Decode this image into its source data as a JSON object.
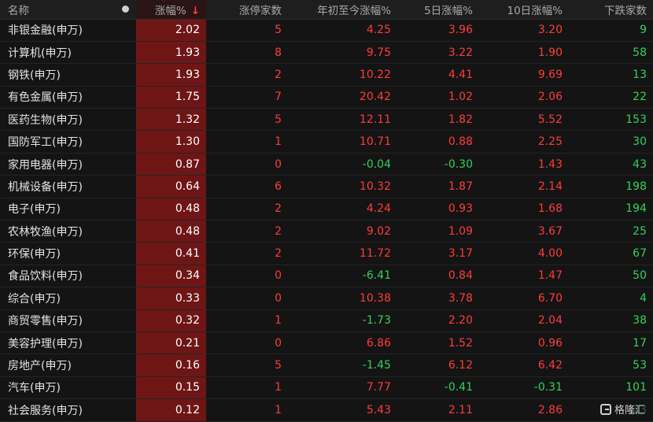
{
  "columns": {
    "name": "名称",
    "change": "涨幅%",
    "sort_indicator": "↓",
    "limit_up": "涨停家数",
    "ytd": "年初至今涨幅%",
    "d5": "5日涨幅%",
    "d10": "10日涨幅%",
    "decliners": "下跌家数"
  },
  "rows": [
    {
      "name": "非银金融(申万)",
      "change": "2.02",
      "limit_up": "5",
      "ytd": "4.25",
      "d5": "3.96",
      "d10": "3.20",
      "decliners": "9"
    },
    {
      "name": "计算机(申万)",
      "change": "1.93",
      "limit_up": "8",
      "ytd": "9.75",
      "d5": "3.22",
      "d10": "1.90",
      "decliners": "58"
    },
    {
      "name": "钢铁(申万)",
      "change": "1.93",
      "limit_up": "2",
      "ytd": "10.22",
      "d5": "4.41",
      "d10": "9.69",
      "decliners": "13"
    },
    {
      "name": "有色金属(申万)",
      "change": "1.75",
      "limit_up": "7",
      "ytd": "20.42",
      "d5": "1.02",
      "d10": "2.06",
      "decliners": "22"
    },
    {
      "name": "医药生物(申万)",
      "change": "1.32",
      "limit_up": "5",
      "ytd": "12.11",
      "d5": "1.82",
      "d10": "5.52",
      "decliners": "153"
    },
    {
      "name": "国防军工(申万)",
      "change": "1.30",
      "limit_up": "1",
      "ytd": "10.71",
      "d5": "0.88",
      "d10": "2.25",
      "decliners": "30"
    },
    {
      "name": "家用电器(申万)",
      "change": "0.87",
      "limit_up": "0",
      "ytd": "-0.04",
      "d5": "-0.30",
      "d10": "1.43",
      "decliners": "43"
    },
    {
      "name": "机械设备(申万)",
      "change": "0.64",
      "limit_up": "6",
      "ytd": "10.32",
      "d5": "1.87",
      "d10": "2.14",
      "decliners": "198"
    },
    {
      "name": "电子(申万)",
      "change": "0.48",
      "limit_up": "2",
      "ytd": "4.24",
      "d5": "0.93",
      "d10": "1.68",
      "decliners": "194"
    },
    {
      "name": "农林牧渔(申万)",
      "change": "0.48",
      "limit_up": "2",
      "ytd": "9.02",
      "d5": "1.09",
      "d10": "3.67",
      "decliners": "25"
    },
    {
      "name": "环保(申万)",
      "change": "0.41",
      "limit_up": "2",
      "ytd": "11.72",
      "d5": "3.17",
      "d10": "4.00",
      "decliners": "67"
    },
    {
      "name": "食品饮料(申万)",
      "change": "0.34",
      "limit_up": "0",
      "ytd": "-6.41",
      "d5": "0.84",
      "d10": "1.47",
      "decliners": "50"
    },
    {
      "name": "综合(申万)",
      "change": "0.33",
      "limit_up": "0",
      "ytd": "10.38",
      "d5": "3.78",
      "d10": "6.70",
      "decliners": "4"
    },
    {
      "name": "商贸零售(申万)",
      "change": "0.32",
      "limit_up": "1",
      "ytd": "-1.73",
      "d5": "2.20",
      "d10": "2.04",
      "decliners": "38"
    },
    {
      "name": "美容护理(申万)",
      "change": "0.21",
      "limit_up": "0",
      "ytd": "6.86",
      "d5": "1.52",
      "d10": "0.96",
      "decliners": "17"
    },
    {
      "name": "房地产(申万)",
      "change": "0.16",
      "limit_up": "5",
      "ytd": "-1.45",
      "d5": "6.12",
      "d10": "6.42",
      "decliners": "53"
    },
    {
      "name": "汽车(申万)",
      "change": "0.15",
      "limit_up": "1",
      "ytd": "7.77",
      "d5": "-0.41",
      "d10": "-0.31",
      "decliners": "101"
    },
    {
      "name": "社会服务(申万)",
      "change": "0.12",
      "limit_up": "1",
      "ytd": "5.43",
      "d5": "2.11",
      "d10": "2.86",
      "decliners": "23"
    }
  ],
  "colors": {
    "up": "#ff3b3b",
    "down": "#35d15a",
    "highlight_column": "#6e1616",
    "background": "#141414"
  },
  "watermark": {
    "text": "格隆汇",
    "icon": "glh-logo-icon"
  }
}
